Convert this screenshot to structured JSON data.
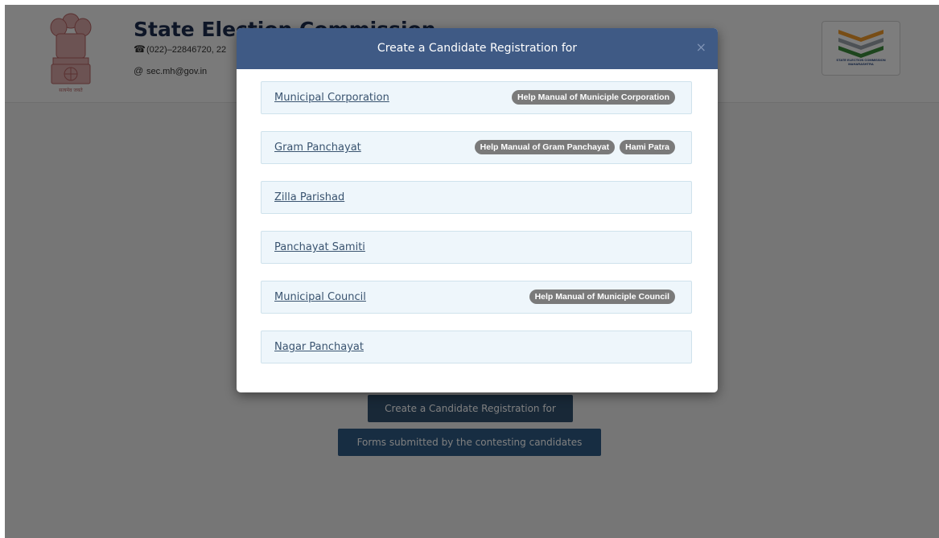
{
  "header": {
    "site_title": "State Election Commission",
    "phone": "(022)–22846720, 22",
    "email": "sec.mh@gov.in",
    "emblem_caption": "सत्यमेव जयते",
    "logo_caption_line1": "STATE ELECTION COMMISSION",
    "logo_caption_line2": "MAHARASHTRA"
  },
  "main": {
    "create_button": "Create a Candidate Registration for",
    "forms_button": "Forms submitted by the contesting candidates"
  },
  "modal": {
    "title": "Create a Candidate Registration for",
    "close": "×",
    "options": [
      {
        "label": "Municipal Corporation",
        "badges": [
          "Help Manual of Municiple Corporation"
        ]
      },
      {
        "label": "Gram Panchayat",
        "badges": [
          "Help Manual of Gram Panchayat",
          "Hami Patra"
        ]
      },
      {
        "label": "Zilla Parishad",
        "badges": []
      },
      {
        "label": "Panchayat Samiti",
        "badges": []
      },
      {
        "label": "Municipal Council",
        "badges": [
          "Help Manual of Municiple Council"
        ]
      },
      {
        "label": "Nagar Panchayat",
        "badges": []
      }
    ]
  },
  "colors": {
    "modal_header": "#3f5a85",
    "badge": "#7a7a7a",
    "option_bg": "#eef6fb",
    "button_dark": "#31506f",
    "button_blue": "#2e5b85"
  },
  "icons": {
    "phone": "phone-icon",
    "email": "at-sign-icon",
    "close": "close-icon"
  }
}
